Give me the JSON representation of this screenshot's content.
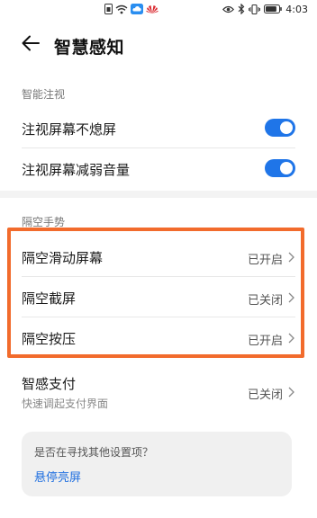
{
  "status_bar": {
    "time": "4:03",
    "battery_level": 0.85,
    "icons": [
      "sim-icon",
      "wifi-icon",
      "cloud-icon",
      "huawei-logo-icon",
      "eye-icon",
      "bluetooth-icon",
      "vibrate-icon",
      "battery-icon"
    ]
  },
  "header": {
    "title": "智慧感知",
    "back_icon": "back-arrow-icon"
  },
  "sections": {
    "smart_gaze": {
      "label": "智能注视",
      "items": [
        {
          "label": "注视屏幕不熄屏",
          "toggle_on": true
        },
        {
          "label": "注视屏幕减弱音量",
          "toggle_on": true
        }
      ]
    },
    "air_gesture": {
      "label": "隔空手势",
      "items": [
        {
          "label": "隔空滑动屏幕",
          "status": "已开启"
        },
        {
          "label": "隔空截屏",
          "status": "已关闭"
        },
        {
          "label": "隔空按压",
          "status": "已开启"
        }
      ]
    },
    "smart_pay": {
      "label": "智感支付",
      "sublabel": "快速调起支付界面",
      "status": "已关闭"
    }
  },
  "tip_card": {
    "question": "是否在寻找其他设置项？",
    "link": "悬停亮屏"
  },
  "colors": {
    "accent": "#1f75e8",
    "highlight_border": "#f26b2c"
  }
}
